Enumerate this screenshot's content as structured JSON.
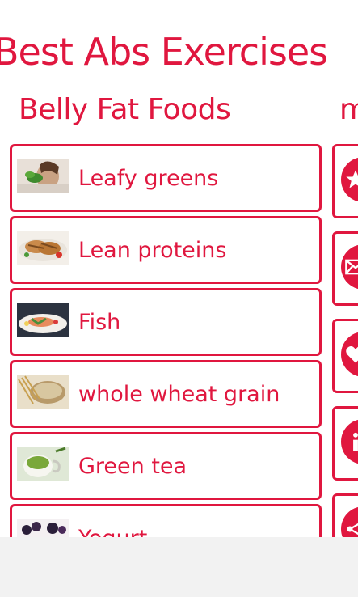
{
  "app": {
    "title": "Best Abs Exercises"
  },
  "section": {
    "title": "Belly Fat Foods",
    "next_title_partial": "m"
  },
  "items": [
    {
      "label": "Leafy greens",
      "image": "woman-eating-greens-photo"
    },
    {
      "label": "Lean proteins",
      "image": "grilled-chicken-photo"
    },
    {
      "label": "Fish",
      "image": "fish-plate-photo"
    },
    {
      "label": "whole wheat grain",
      "image": "grain-bowl-photo"
    },
    {
      "label": "Green tea",
      "image": "green-tea-cup-photo"
    },
    {
      "label": "Yogurt",
      "image": "yogurt-berries-photo"
    }
  ],
  "side_icons": [
    "star-icon",
    "mail-icon",
    "heart-icon",
    "info-icon",
    "share-icon"
  ],
  "colors": {
    "accent": "#e0173f",
    "background": "#ffffff",
    "app_bar": "#f2f2f2"
  }
}
